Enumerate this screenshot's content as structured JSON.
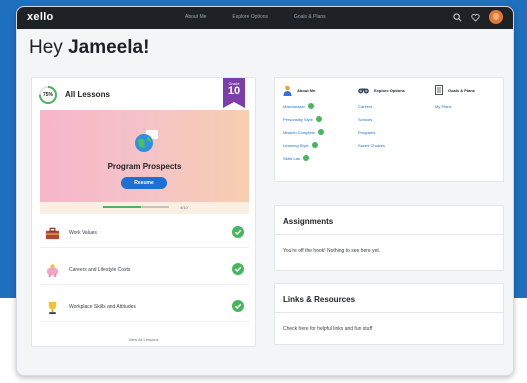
{
  "nav": {
    "logo": "xello",
    "links": [
      "About Me",
      "Explore Options",
      "Goals & Plans"
    ]
  },
  "greeting": {
    "prefix": "Hey ",
    "name": "Jameela!"
  },
  "lessons": {
    "progress_label": "75%",
    "progress": 0.75,
    "title": "All Lessons",
    "grade_label": "Grade",
    "grade_number": "10",
    "featured": {
      "title": "Program Prospects",
      "button": "Resume",
      "step": "4/10",
      "progress": 0.57
    },
    "items": [
      {
        "label": "Work Values",
        "icon": "briefcase-icon",
        "done": true
      },
      {
        "label": "Careers and Lifestyle Costs",
        "icon": "piggy-bank-icon",
        "done": true
      },
      {
        "label": "Workplace Skills and Attitudes",
        "icon": "trophy-icon",
        "done": true
      }
    ],
    "view_all": "View All Lessons"
  },
  "about": {
    "columns": [
      {
        "heading": "About Me",
        "icon": "person-icon",
        "items": [
          "Matchmaker",
          "Personality Style",
          "Mission Complete",
          "Learning Style",
          "Skills Lab"
        ]
      },
      {
        "heading": "Explore Options",
        "icon": "binoculars-icon",
        "items": [
          "Careers",
          "Schools",
          "Programs",
          "Saved Choices"
        ]
      },
      {
        "heading": "Goals & Plans",
        "icon": "notebook-icon",
        "items": [
          "My Plans"
        ]
      }
    ]
  },
  "assignments": {
    "title": "Assignments",
    "body": "You're off the hook! Nothing to see here yet."
  },
  "links": {
    "title": "Links & Resources",
    "body": "Check here for helpful links and fun stuff"
  },
  "colors": {
    "accent": "#1d6fd0",
    "success": "#49b560",
    "grade_badge": "#7a3fa8",
    "nav_bg": "#1e2226",
    "backdrop": "#1f6fbf"
  }
}
